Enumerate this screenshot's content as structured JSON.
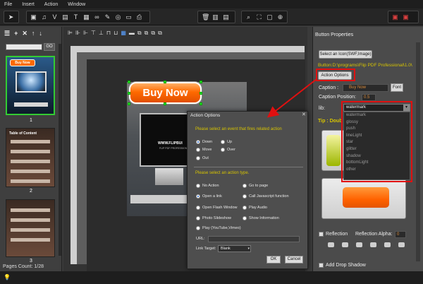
{
  "menu": [
    "File",
    "Insert",
    "Action",
    "Window"
  ],
  "toolbar": {
    "group1_icons": [
      "pointer-icon"
    ],
    "group2_icons": [
      "image-icon",
      "text-icon",
      "video-icon",
      "music-icon",
      "text-tool-icon",
      "picture-icon",
      "link-icon",
      "brush-icon",
      "circle-icon",
      "badge-icon",
      "print-icon"
    ],
    "group3_icons": [
      "delete-icon",
      "table-icon",
      "layer-icon"
    ],
    "group4_icons": [
      "zoom-icon",
      "fit-icon",
      "screen-icon",
      "zoom-in-icon"
    ],
    "group5_icons": [
      "save-icon",
      "exit-icon"
    ]
  },
  "left": {
    "tools": [
      "☰",
      "+",
      "✕",
      "↑",
      "↓"
    ],
    "go_label": "GO",
    "page_numbers": [
      "1",
      "2",
      "3"
    ],
    "page2_title": "Table of Content",
    "pages_count": "Pages Count: 1/28"
  },
  "canvas": {
    "buy_now_label": "Buy Now",
    "brand_text": "WWW.FLIPBUI",
    "brand_sub": "FLIP PDF PROFESSIONAL"
  },
  "right": {
    "title": "Button Properties",
    "select_icon_label": "Select an Icon(SWF,Image)",
    "button_path": "Button:D:\\programs\\Flip PDF Professional\\1.0\\",
    "action_options_label": "Action Options",
    "caption_label": "Caption :",
    "caption_value": "Buy Now",
    "font_label": "Font",
    "caption_position_label": "Caption Position:",
    "caption_position_value": "0.5",
    "lib_label": "lib:",
    "lib_selected": "watermark",
    "lib_items": [
      "watermark",
      "glossy",
      "push",
      "lineLight",
      "star",
      "glitter",
      "shadow",
      "bottomLight",
      "other"
    ],
    "tip_label": "Tip : Doub",
    "reflection_label": "Reflection",
    "reflection_alpha_label": "Reflection Alpha:",
    "reflection_alpha_value": "0",
    "drop_shadow_label": "Add Drop Shadow"
  },
  "dialog": {
    "title": "Action Options",
    "close": "✕",
    "event_prompt": "Please select an event that fires related action",
    "events": [
      "Down",
      "Up",
      "Move",
      "Over",
      "Out"
    ],
    "selected_event": "Down",
    "action_prompt": "Please select an action type.",
    "actions": [
      "No Action",
      "Go to page",
      "Open a link",
      "Call Javascript function",
      "Open Flash Window",
      "Play Audio",
      "Photo Slideshow",
      "Show Information",
      "Play (YouTube,Vimeo)"
    ],
    "selected_action": "Open a link",
    "url_label": "URL:",
    "link_target_label": "Link Target:",
    "link_target_value": "Blank",
    "ok_label": "OK",
    "cancel_label": "Cancel"
  },
  "colors": {
    "annotation_red": "#e01010",
    "accent_yellow": "#d7c400",
    "button_orange": "#ff6a00"
  }
}
